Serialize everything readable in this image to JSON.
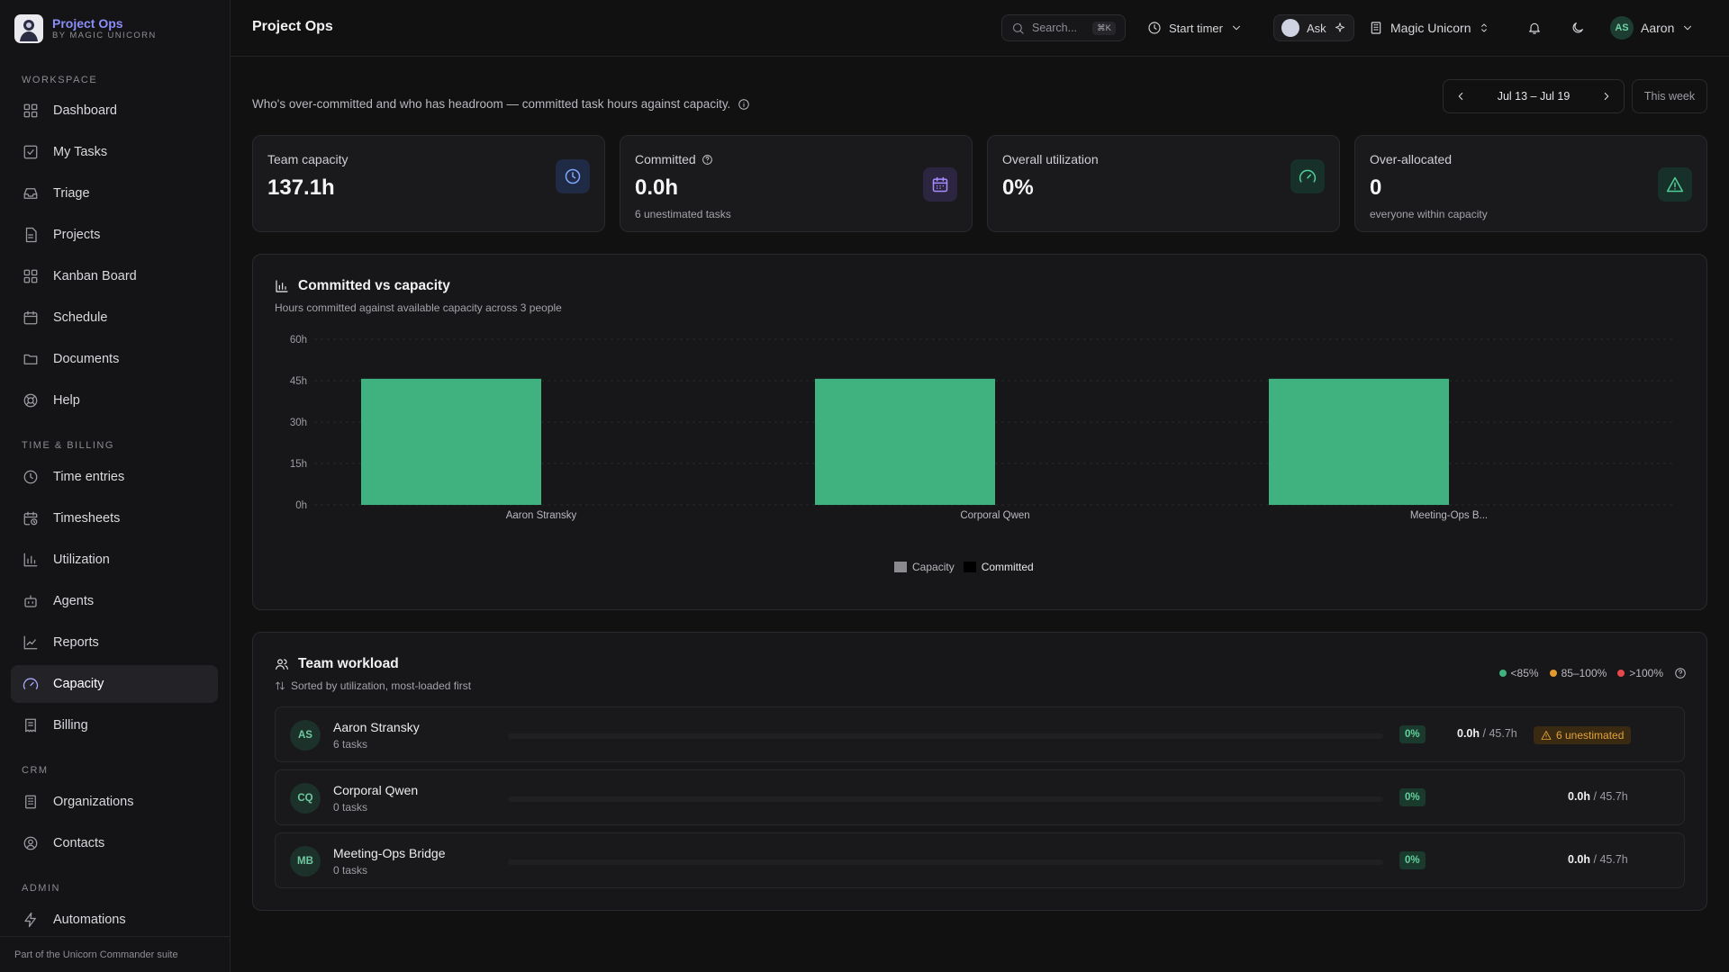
{
  "brand": {
    "name": "Project Ops",
    "sub": "BY MAGIC UNICORN"
  },
  "sidebar": {
    "sections": [
      {
        "label": "WORKSPACE",
        "items": [
          {
            "label": "Dashboard",
            "icon": "dashboard-icon"
          },
          {
            "label": "My Tasks",
            "icon": "checkbox-icon"
          },
          {
            "label": "Triage",
            "icon": "inbox-icon"
          },
          {
            "label": "Projects",
            "icon": "file-icon"
          },
          {
            "label": "Kanban Board",
            "icon": "kanban-icon"
          },
          {
            "label": "Schedule",
            "icon": "calendar-icon"
          },
          {
            "label": "Documents",
            "icon": "folder-icon"
          },
          {
            "label": "Help",
            "icon": "lifebuoy-icon"
          }
        ]
      },
      {
        "label": "TIME & BILLING",
        "items": [
          {
            "label": "Time entries",
            "icon": "clock-icon"
          },
          {
            "label": "Timesheets",
            "icon": "calendar-clock-icon"
          },
          {
            "label": "Utilization",
            "icon": "bar-chart-icon"
          },
          {
            "label": "Agents",
            "icon": "bot-icon"
          },
          {
            "label": "Reports",
            "icon": "line-chart-icon"
          },
          {
            "label": "Capacity",
            "icon": "gauge-icon",
            "active": true
          },
          {
            "label": "Billing",
            "icon": "receipt-icon"
          }
        ]
      },
      {
        "label": "CRM",
        "items": [
          {
            "label": "Organizations",
            "icon": "building-icon"
          },
          {
            "label": "Contacts",
            "icon": "contact-icon"
          }
        ]
      },
      {
        "label": "ADMIN",
        "items": [
          {
            "label": "Automations",
            "icon": "zap-icon"
          }
        ]
      }
    ],
    "footer": "Part of the Unicorn Commander suite"
  },
  "header": {
    "title": "Project Ops",
    "search_placeholder": "Search...",
    "search_shortcut": "⌘K",
    "timer_label": "Start timer",
    "ask_label": "Ask",
    "org_name": "Magic Unicorn",
    "user_initials": "AS",
    "user_name": "Aaron"
  },
  "main": {
    "subtitle": "Who's over-committed and who has headroom — committed task hours against capacity.",
    "date_range": "Jul 13 – Jul 19",
    "this_week": "This week",
    "stats": [
      {
        "label": "Team capacity",
        "value": "137.1h",
        "sub": "",
        "icon": "clock-icon",
        "icon_bg": "#1f2a44",
        "icon_color": "#7ea6ff"
      },
      {
        "label": "Committed",
        "value": "0.0h",
        "sub": "6 unestimated tasks",
        "icon": "calendar-icon",
        "icon_bg": "#2c2540",
        "icon_color": "#a88cff"
      },
      {
        "label": "Overall utilization",
        "value": "0%",
        "sub": "",
        "icon": "gauge-icon",
        "icon_bg": "#17302a",
        "icon_color": "#4fcf95"
      },
      {
        "label": "Over-allocated",
        "value": "0",
        "sub": "everyone within capacity",
        "icon": "warning-icon",
        "icon_bg": "#17302a",
        "icon_color": "#4fcf95"
      }
    ]
  },
  "chart_panel": {
    "title": "Committed vs capacity",
    "subtitle": "Hours committed against available capacity across 3 people"
  },
  "chart_data": {
    "type": "bar",
    "categories": [
      "Aaron Stransky",
      "Corporal Qwen",
      "Meeting-Ops B..."
    ],
    "series": [
      {
        "name": "Capacity",
        "values": [
          45.7,
          45.7,
          45.7
        ],
        "color": "#3fb27f"
      },
      {
        "name": "Committed",
        "values": [
          0,
          0,
          0
        ],
        "color": "#000000"
      }
    ],
    "y_ticks": [
      "0h",
      "15h",
      "30h",
      "45h",
      "60h"
    ],
    "ylim": [
      0,
      60
    ],
    "legend_colors": [
      "#8a8a8f",
      "#000000"
    ],
    "grid": true,
    "legend_position": "bottom"
  },
  "workload": {
    "title": "Team workload",
    "subtitle": "Sorted by utilization, most-loaded first",
    "legend": [
      {
        "label": "<85%",
        "color": "#3fb27f"
      },
      {
        "label": "85–100%",
        "color": "#e39a2b"
      },
      {
        "label": ">100%",
        "color": "#e5484d"
      }
    ],
    "rows": [
      {
        "initials": "AS",
        "name": "Aaron Stransky",
        "tasks": "6 tasks",
        "utilization": 0,
        "pct": "0%",
        "committed": "0.0h",
        "capacity": "/ 45.7h",
        "warning": "6 unestimated"
      },
      {
        "initials": "CQ",
        "name": "Corporal Qwen",
        "tasks": "0 tasks",
        "utilization": 0,
        "pct": "0%",
        "committed": "0.0h",
        "capacity": "/ 45.7h",
        "warning": ""
      },
      {
        "initials": "MB",
        "name": "Meeting-Ops Bridge",
        "tasks": "0 tasks",
        "utilization": 0,
        "pct": "0%",
        "committed": "0.0h",
        "capacity": "/ 45.7h",
        "warning": ""
      }
    ]
  }
}
